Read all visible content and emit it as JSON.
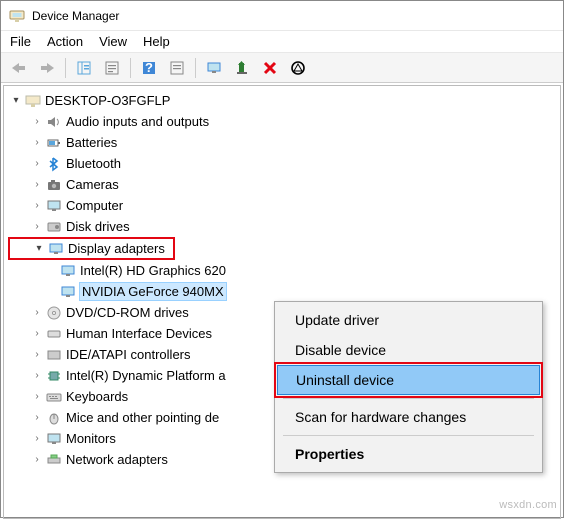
{
  "titlebar": {
    "title": "Device Manager"
  },
  "menu": {
    "file": "File",
    "action": "Action",
    "view": "View",
    "help": "Help"
  },
  "root": {
    "computer": "DESKTOP-O3FGFLP"
  },
  "tree": {
    "audio": "Audio inputs and outputs",
    "batteries": "Batteries",
    "bluetooth": "Bluetooth",
    "cameras": "Cameras",
    "computer": "Computer",
    "disk": "Disk drives",
    "display": "Display adapters",
    "display_intel": "Intel(R) HD Graphics 620",
    "display_nvidia": "NVIDIA GeForce 940MX",
    "dvd": "DVD/CD-ROM drives",
    "hid": "Human Interface Devices",
    "ide": "IDE/ATAPI controllers",
    "dptf": "Intel(R) Dynamic Platform a",
    "keyboards": "Keyboards",
    "mice": "Mice and other pointing de",
    "monitors": "Monitors",
    "network": "Network adapters"
  },
  "context": {
    "update": "Update driver",
    "disable": "Disable device",
    "uninstall": "Uninstall device",
    "scan": "Scan for hardware changes",
    "properties": "Properties"
  },
  "watermark": "wsxdn.com"
}
